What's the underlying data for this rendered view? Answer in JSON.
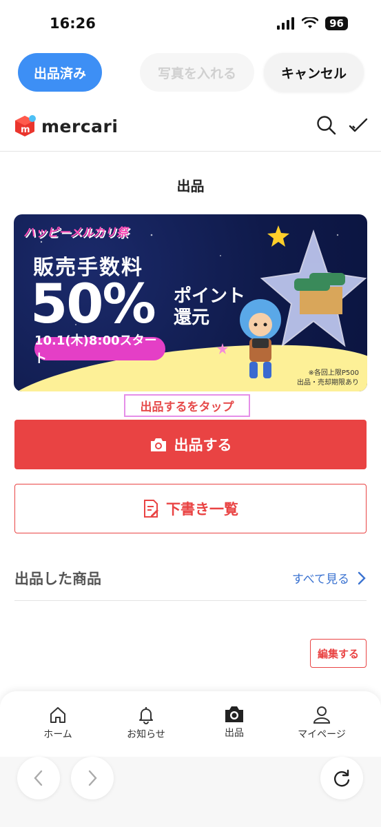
{
  "status_bar": {
    "time": "16:26",
    "battery": "96"
  },
  "top_actions": {
    "listed_label": "出品済み",
    "add_photo_label": "写真を入れる",
    "cancel_label": "キャンセル"
  },
  "header": {
    "logo_text": "mercari"
  },
  "page_title": "出品",
  "banner": {
    "campaign": "ハッピーメルカリ祭",
    "line1": "販売手数料",
    "percent": "50%",
    "point_line1": "ポイント",
    "point_line2": "還元",
    "date": "10.1(木)8:00スタート",
    "note_line1": "※各回上限P500",
    "note_line2": "出品・売却期限あり"
  },
  "tap_hint": "出品するをタップ",
  "buttons": {
    "list_label": "出品する",
    "drafts_label": "下書き一覧"
  },
  "listed_section": {
    "title": "出品した商品",
    "see_all": "すべて見る",
    "edit_label": "編集する"
  },
  "bottom_nav": {
    "items": [
      {
        "label": "ホーム",
        "icon": "home-icon"
      },
      {
        "label": "お知らせ",
        "icon": "bell-icon"
      },
      {
        "label": "出品",
        "icon": "camera-icon"
      },
      {
        "label": "マイページ",
        "icon": "user-icon"
      }
    ]
  },
  "colors": {
    "accent_red": "#e94343",
    "primary_blue": "#3d8ff5",
    "link_blue": "#3b73d1"
  }
}
